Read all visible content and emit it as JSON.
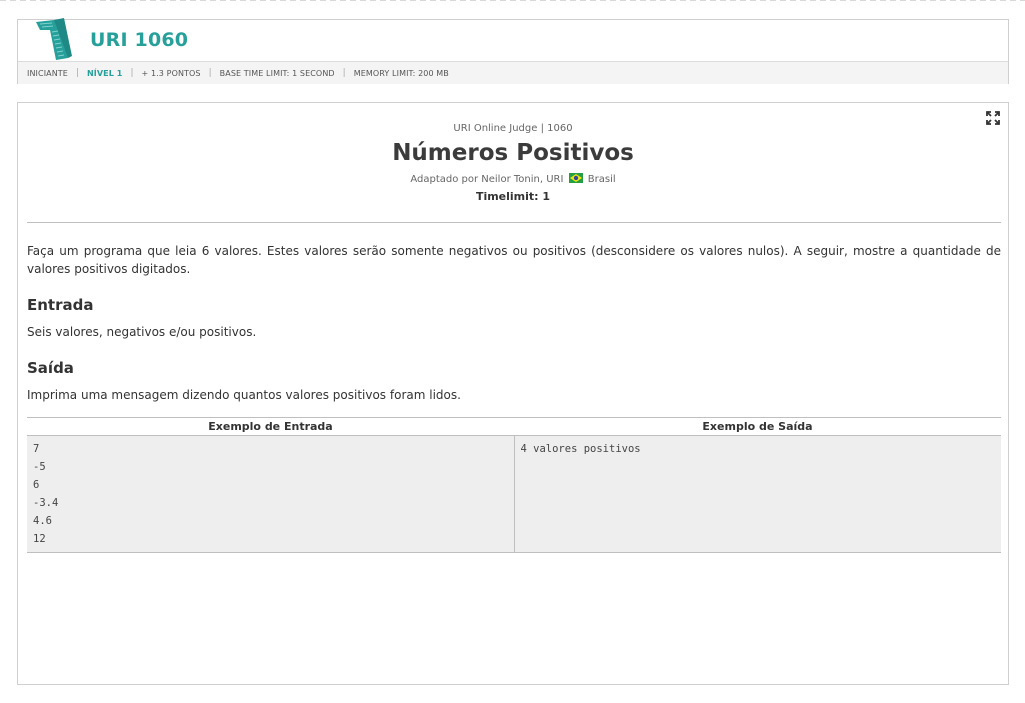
{
  "header": {
    "problem_code": "URI 1060",
    "meta": {
      "category": "INICIANTE",
      "level": "NÍVEL 1",
      "points": "+ 1.3 PONTOS",
      "time_limit": "BASE TIME LIMIT: 1 SECOND",
      "memory_limit": "MEMORY LIMIT: 200 MB"
    },
    "colors": {
      "accent": "#27a09b"
    }
  },
  "problem": {
    "judge_line": "URI Online Judge | 1060",
    "title": "Números Positivos",
    "author_prefix": "Adaptado por Neilor Tonin, URI",
    "country": "Brasil",
    "timelimit": "Timelimit: 1",
    "description": "Faça um programa que leia 6 valores. Estes valores serão somente negativos ou positivos (desconsidere os valores nulos). A seguir, mostre a quantidade de valores positivos digitados.",
    "input_heading": "Entrada",
    "input_text": "Seis valores, negativos e/ou positivos.",
    "output_heading": "Saída",
    "output_text": "Imprima uma mensagem dizendo quantos valores positivos foram lidos."
  },
  "samples": {
    "input_header": "Exemplo de Entrada",
    "output_header": "Exemplo de Saída",
    "input_lines": [
      "7",
      "-5",
      "6",
      "-3.4",
      "4.6",
      "12"
    ],
    "output_lines": [
      "4 valores positivos"
    ]
  },
  "icons": {
    "expand": "expand-icon",
    "logo": "logo-mark-icon",
    "flag": "brazil-flag-icon"
  }
}
